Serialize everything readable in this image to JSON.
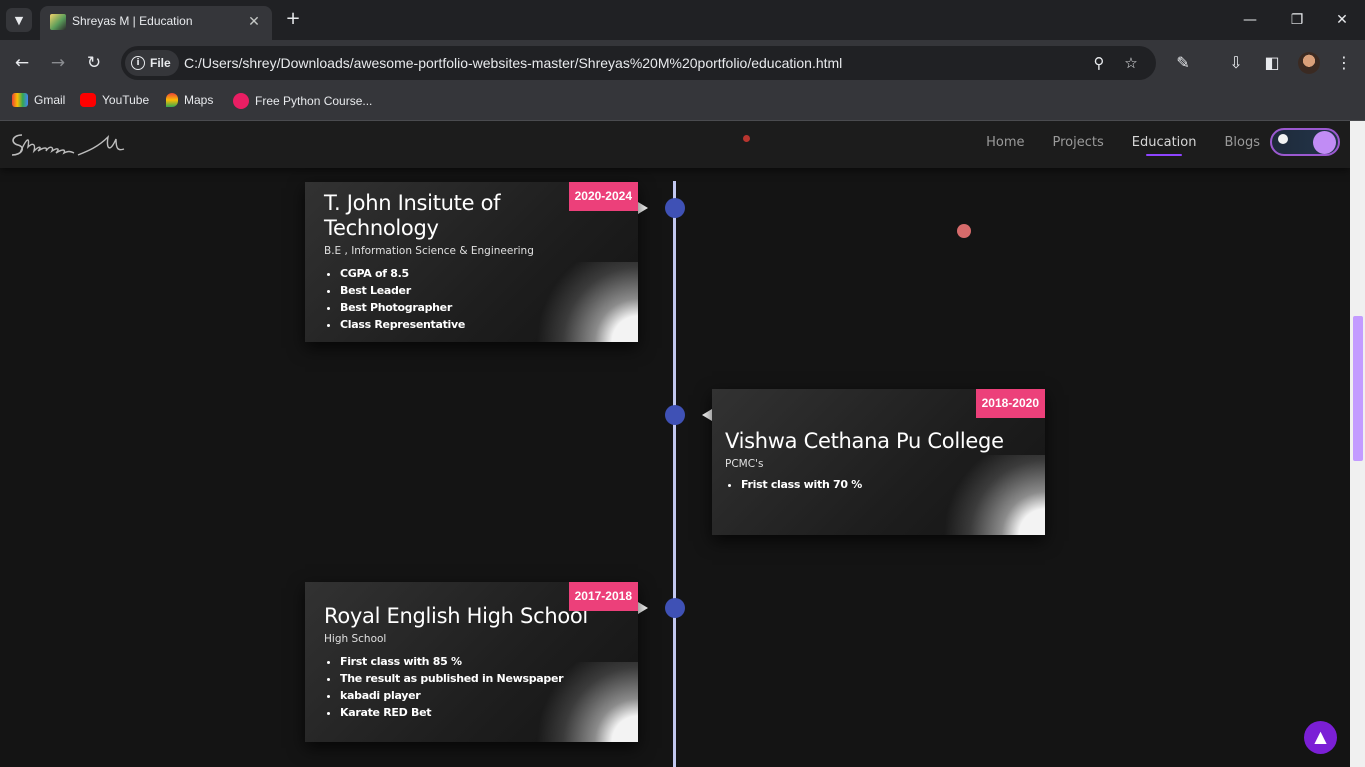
{
  "browser": {
    "tab_title": "Shreyas M | Education",
    "file_label": "File",
    "url": "C:/Users/shrey/Downloads/awesome-portfolio-websites-master/Shreyas%20M%20portfolio/education.html",
    "bookmarks": [
      {
        "label": "Gmail",
        "icon": "gmail-icon"
      },
      {
        "label": "YouTube",
        "icon": "youtube-icon"
      },
      {
        "label": "Maps",
        "icon": "maps-icon"
      },
      {
        "label": "Free Python Course...",
        "icon": "python-course-icon"
      }
    ]
  },
  "site": {
    "logo_text": "Shreyas M",
    "nav": [
      "Home",
      "Projects",
      "Education",
      "Blogs"
    ],
    "active_nav": "Education"
  },
  "timeline": [
    {
      "date": "2020-2024",
      "title": "T. John Insitute of Technology",
      "subtitle": "B.E , Information Science & Engineering",
      "points": [
        "CGPA of 8.5",
        "Best Leader",
        "Best Photographer",
        "Class Representative"
      ]
    },
    {
      "date": "2018-2020",
      "title": "Vishwa Cethana Pu College",
      "subtitle": "PCMC's",
      "points": [
        "Frist class with 70 %"
      ]
    },
    {
      "date": "2017-2018",
      "title": "Royal English High School",
      "subtitle": "High School",
      "points": [
        "First class with 85 %",
        "The result as published in Newspaper",
        "kabadi player",
        "Karate RED Bet"
      ]
    }
  ],
  "colors": {
    "accent": "#8e44ff",
    "date_badge": "#ec407a",
    "timeline_dot": "#3f51b5"
  }
}
